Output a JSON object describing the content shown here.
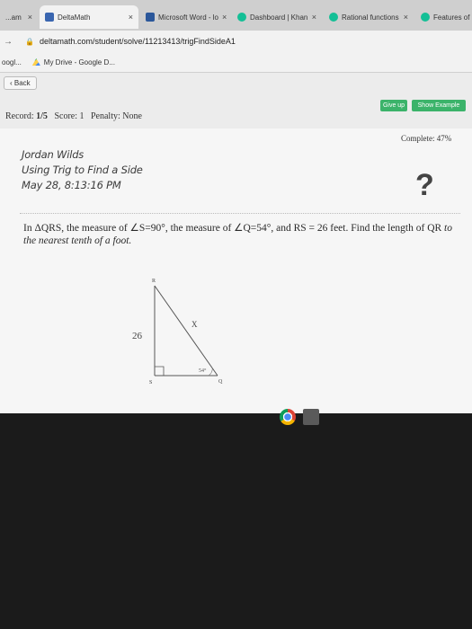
{
  "tabs": [
    {
      "label": "...am",
      "active": false
    },
    {
      "label": "DeltaMath",
      "active": true
    },
    {
      "label": "Microsoft Word - lo",
      "active": false
    },
    {
      "label": "Dashboard | Khan",
      "active": false
    },
    {
      "label": "Rational functions",
      "active": false
    },
    {
      "label": "Features of sin",
      "active": false
    }
  ],
  "address": {
    "url": "deltamath.com/student/solve/11213413/trigFindSideA1"
  },
  "bookmarks": [
    {
      "label": "oogl..."
    },
    {
      "label": "My Drive - Google D..."
    }
  ],
  "toolbar": {
    "back": "‹ Back",
    "give_up": "Give up",
    "show_example": "Show Example"
  },
  "status": {
    "record_label": "Record:",
    "record_value": "1/5",
    "score_label": "Score:",
    "score_value": "1",
    "penalty": "Penalty: None",
    "complete": "Complete: 47%"
  },
  "header": {
    "name": "Jordan Wilds",
    "topic": "Using Trig to Find a Side",
    "timestamp": "May 28, 8:13:16 PM",
    "help": "?"
  },
  "question": {
    "text_main": "In ΔQRS, the measure of ∠S=90°, the measure of ∠Q=54°, and RS = 26 feet. Find the length of QR ",
    "text_italic": "to the nearest tenth of a foot."
  },
  "diagram": {
    "vertex_r": "R",
    "vertex_s": "S",
    "vertex_q": "Q",
    "side_rs": "26",
    "side_qr": "X",
    "angle_q": "54°"
  },
  "colors": {
    "accent_green": "#3bb36a",
    "tab_active": "#f2f2f2",
    "page_bg": "#f6f6f6"
  }
}
